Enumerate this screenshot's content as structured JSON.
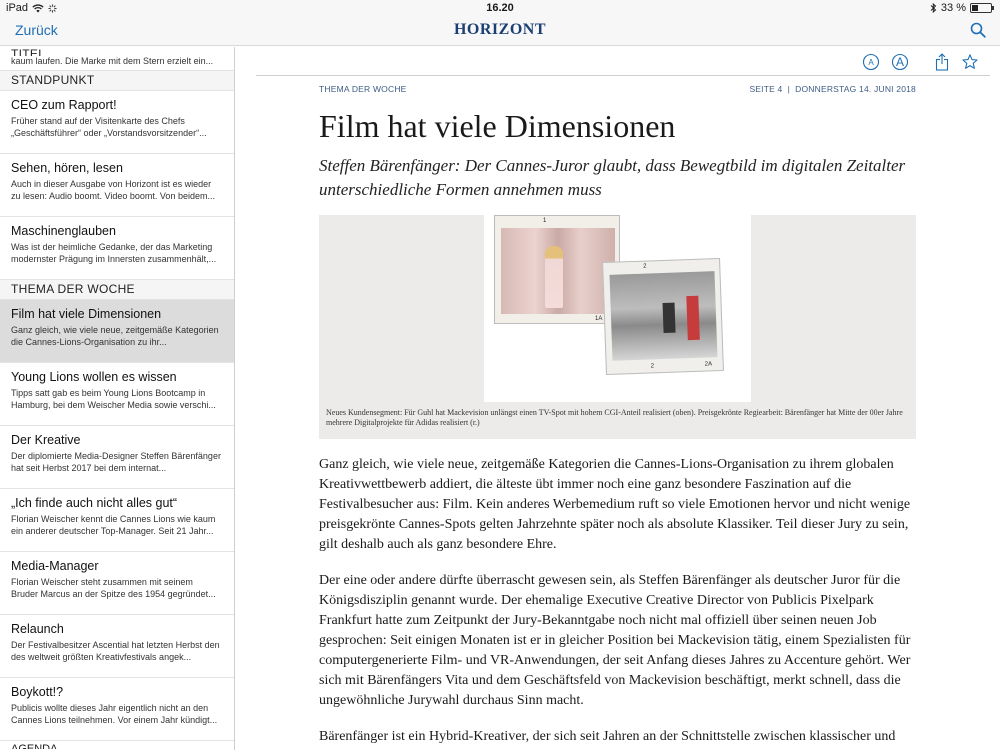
{
  "status": {
    "device": "iPad",
    "time": "16.20",
    "battery": "33 %",
    "battery_level": 0.33
  },
  "nav": {
    "back_label": "Zurück",
    "logo": "HORIZONT"
  },
  "sidebar": {
    "first_head": "TITEL",
    "first_cut": "kaum laufen. Die Marke mit dem Stern erzielt ein...",
    "sections": [
      {
        "head": "STANDPUNKT",
        "items": [
          {
            "title": "CEO zum Rapport!",
            "snippet": "Früher stand auf der Visitenkarte des Chefs „Geschäftsführer“ oder „Vorstandsvorsitzender“..."
          },
          {
            "title": "Sehen, hören, lesen",
            "snippet": "Auch in dieser Ausgabe von Horizont ist es wieder zu lesen: Audio boomt. Video boomt. Von beidem..."
          },
          {
            "title": "Maschinenglauben",
            "snippet": "Was ist der heimliche Gedanke, der das Marketing modernster Prägung im Innersten zusammenhält,..."
          }
        ]
      },
      {
        "head": "THEMA DER WOCHE",
        "items": [
          {
            "title": "Film hat viele Dimensionen",
            "snippet": "Ganz gleich, wie viele neue, zeitgemäße Kategorien die Cannes-Lions-Organisation zu ihr...",
            "active": true
          },
          {
            "title": "Young Lions wollen es wissen",
            "snippet": "Tipps satt gab es beim Young Lions Bootcamp in Hamburg, bei dem Weischer Media sowie verschi..."
          },
          {
            "title": "Der Kreative",
            "snippet": "Der diplomierte Media-Designer Steffen Bärenfänger hat seit Herbst 2017 bei dem internat..."
          },
          {
            "title": "„Ich finde auch nicht alles gut“",
            "snippet": "Florian Weischer kennt die Cannes Lions wie kaum ein anderer deutscher Top-Manager. Seit 21 Jahr..."
          },
          {
            "title": "Media-Manager",
            "snippet": "Florian Weischer steht zusammen mit seinem Bruder Marcus an der Spitze des 1954 gegründet..."
          },
          {
            "title": "Relaunch",
            "snippet": "Der Festivalbesitzer Ascential hat letzten Herbst den  des weltweit größten Kreativfestivals angek..."
          },
          {
            "title": "Boykott!?",
            "snippet": "Publicis wollte dieses Jahr eigentlich nicht an den Cannes Lions teilnehmen. Vor einem Jahr kündigt..."
          }
        ]
      }
    ],
    "tail_head": "AGENDA"
  },
  "article": {
    "section": "THEMA DER WOCHE",
    "page_info": "SEITE 4  |  DONNERSTAG 14. JUNI 2018",
    "headline": "Film hat viele Dimensionen",
    "subline": "Steffen Bärenfänger: Der Cannes-Juror glaubt, dass Bewegtbild im digitalen Zeitalter unterschiedliche Formen annehmen muss",
    "film_numbers": [
      "1",
      "1A",
      "2",
      "2",
      "2A"
    ],
    "caption": "Neues Kundensegment: Für Guhl hat Mackevision unlängst einen TV-Spot mit hohem CGI-Anteil realisiert (oben). Preisgekrönte Regiearbeit: Bärenfänger hat Mitte der 00er Jahre mehrere Digitalprojekte für Adidas realisiert (r.)",
    "paragraphs": [
      "Ganz gleich, wie viele neue, zeitgemäße Kategorien die Cannes-Lions-Organisation zu ihrem globalen Kreativwettbewerb addiert, die älteste übt immer noch eine ganz besondere Faszination auf die Festivalbesucher aus: Film. Kein anderes Werbemedium ruft so viele Emotionen hervor und nicht wenige preisgekrönte Cannes-Spots gelten Jahrzehnte später noch als absolute Klassiker. Teil dieser Jury zu sein, gilt deshalb auch als ganz besondere Ehre.",
      "Der eine oder andere dürfte überrascht gewesen sein, als Steffen Bärenfänger als deutscher Juror für die Königsdisziplin genannt wurde. Der ehemalige Executive Creative Director von Publicis Pixelpark Frankfurt hatte zum Zeitpunkt der Jury-Bekanntgabe noch nicht mal offiziell über seinen neuen Job gesprochen: Seit einigen Monaten ist er in gleicher Position bei Mackevision tätig, einem Spezialisten für computergenerierte Film- und VR-Anwendungen, der seit Anfang dieses Jahres zu Accenture gehört. Wer sich mit Bärenfängers Vita und dem Geschäftsfeld von Mackevision beschäftigt, merkt schnell, dass die ungewöhnliche Jurywahl durchaus Sinn macht.",
      "Bärenfänger ist ein Hybrid-Kreativer, der sich seit Jahren an der Schnittstelle zwischen klassischer und digitaler Kreation bewegt. Bevor er im Juni 2015 bei Publicis Pixelpark andockte, war er bei Grey"
    ]
  },
  "colors": {
    "accent": "#1e6fb5",
    "logo": "#1b3f73",
    "meta": "#3d5c86",
    "active_row": "#dcdcdc"
  }
}
